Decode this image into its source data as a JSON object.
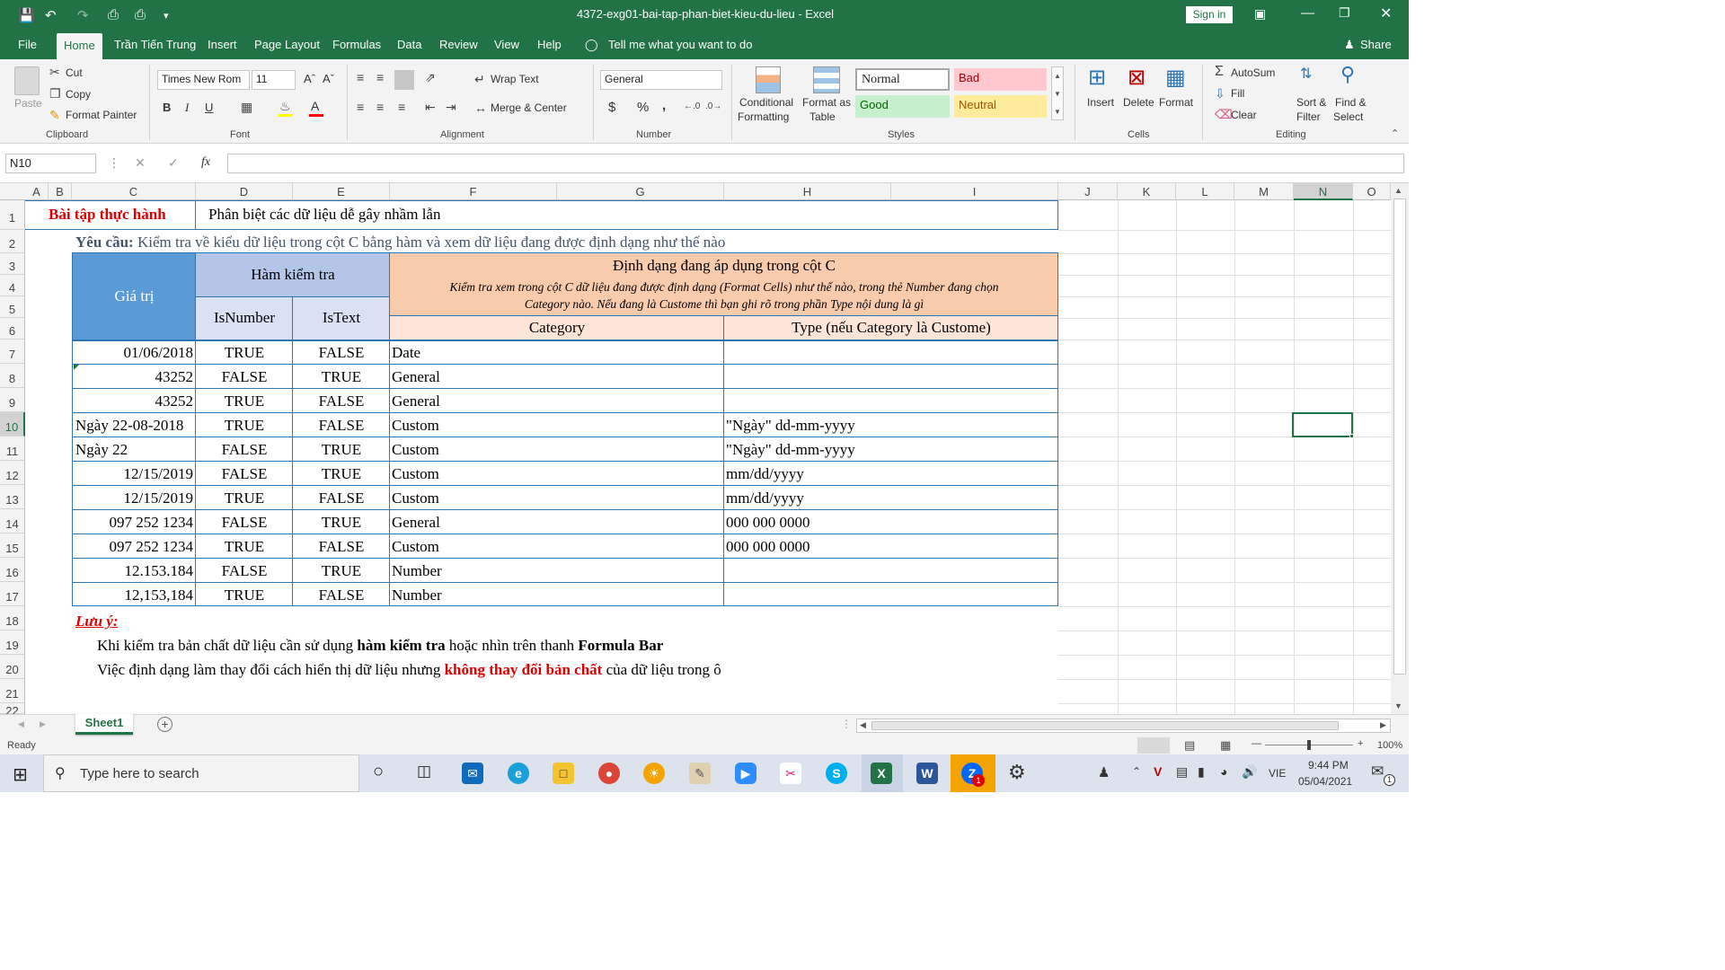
{
  "window": {
    "title": "4372-exg01-bai-tap-phan-biet-kieu-du-lieu  -  Excel",
    "sign_in": "Sign in"
  },
  "tabs": [
    "File",
    "Home",
    "Trần Tiến Trung",
    "Insert",
    "Page Layout",
    "Formulas",
    "Data",
    "Review",
    "View",
    "Help"
  ],
  "tell_me": "Tell me what you want to do",
  "share": "Share",
  "ribbon": {
    "clipboard": {
      "paste": "Paste",
      "cut": "Cut",
      "copy": "Copy",
      "format_painter": "Format Painter",
      "label": "Clipboard"
    },
    "font": {
      "name": "Times New Rom",
      "size": "11",
      "label": "Font",
      "bold": "B",
      "italic": "I",
      "underline": "U"
    },
    "alignment": {
      "wrap_text": "Wrap Text",
      "merge_center": "Merge & Center",
      "label": "Alignment"
    },
    "number": {
      "format": "General",
      "label": "Number",
      "currency": "$",
      "percent": "%",
      "comma": ","
    },
    "styles": {
      "conditional": [
        "Conditional",
        "Formatting"
      ],
      "format_as_table": [
        "Format as",
        "Table"
      ],
      "normal": "Normal",
      "bad": "Bad",
      "good": "Good",
      "neutral": "Neutral",
      "label": "Styles"
    },
    "cells": {
      "insert": "Insert",
      "delete": "Delete",
      "format": "Format",
      "label": "Cells"
    },
    "editing": {
      "autosum": "AutoSum",
      "fill": "Fill",
      "clear": "Clear",
      "sort": [
        "Sort &",
        "Filter"
      ],
      "find": [
        "Find &",
        "Select"
      ],
      "label": "Editing"
    }
  },
  "formula_bar": {
    "name_box": "N10",
    "fx": "fx",
    "value": ""
  },
  "columns": [
    "A",
    "B",
    "C",
    "D",
    "E",
    "F",
    "G",
    "H",
    "I",
    "J",
    "K",
    "L",
    "M",
    "N",
    "O"
  ],
  "rows": [
    "1",
    "2",
    "3",
    "4",
    "5",
    "6",
    "7",
    "8",
    "9",
    "10",
    "11",
    "12",
    "13",
    "14",
    "15",
    "16",
    "17",
    "18",
    "19",
    "20",
    "21",
    "22"
  ],
  "sheet": {
    "title_left": "Bài tập thực hành",
    "title_right": "Phân biệt các dữ liệu dễ gây nhầm lẫn",
    "req_label": "Yêu cầu:",
    "req_text": " Kiểm tra về kiểu dữ liệu trong cột C bằng hàm và xem dữ liệu đang được định dạng như thế nào",
    "hdr_value": "Giá trị",
    "hdr_check": "Hàm kiểm tra",
    "hdr_isnumber": "IsNumber",
    "hdr_istext": "IsText",
    "hdr_format": "Định dạng đang áp dụng trong cột C",
    "hdr_format_note1": "Kiểm tra xem trong cột C dữ liệu đang được định dạng (Format Cells) như thế nào, trong thẻ Number đang chọn",
    "hdr_format_note2": "Category nào. Nếu đang là Custome thì bạn ghi rõ trong phần Type nội dung là gì",
    "hdr_category": "Category",
    "hdr_type": "Type (nếu Category là Custome)",
    "data": [
      {
        "value": "01/06/2018",
        "align": "right",
        "isnumber": "TRUE",
        "istext": "FALSE",
        "category": "Date",
        "type": ""
      },
      {
        "value": "43252",
        "align": "right",
        "isnumber": "FALSE",
        "istext": "TRUE",
        "category": "General",
        "type": ""
      },
      {
        "value": "43252",
        "align": "right",
        "isnumber": "TRUE",
        "istext": "FALSE",
        "category": "General",
        "type": ""
      },
      {
        "value": "Ngày 22-08-2018",
        "align": "left",
        "isnumber": "TRUE",
        "istext": "FALSE",
        "category": "Custom",
        "type": "\"Ngày\" dd-mm-yyyy"
      },
      {
        "value": "Ngày 22",
        "align": "left",
        "isnumber": "FALSE",
        "istext": "TRUE",
        "category": "Custom",
        "type": "\"Ngày\" dd-mm-yyyy"
      },
      {
        "value": "12/15/2019",
        "align": "right",
        "isnumber": "FALSE",
        "istext": "TRUE",
        "category": "Custom",
        "type": "mm/dd/yyyy"
      },
      {
        "value": "12/15/2019",
        "align": "right",
        "isnumber": "TRUE",
        "istext": "FALSE",
        "category": "Custom",
        "type": "mm/dd/yyyy"
      },
      {
        "value": "097 252 1234",
        "align": "right",
        "isnumber": "FALSE",
        "istext": "TRUE",
        "category": "General",
        "type": "000 000 0000"
      },
      {
        "value": "097 252 1234",
        "align": "right",
        "isnumber": "TRUE",
        "istext": "FALSE",
        "category": "Custom",
        "type": "000 000 0000"
      },
      {
        "value": "12.153.184",
        "align": "right",
        "isnumber": "FALSE",
        "istext": "TRUE",
        "category": "Number",
        "type": ""
      },
      {
        "value": "12,153,184",
        "align": "right",
        "isnumber": "TRUE",
        "istext": "FALSE",
        "category": "Number",
        "type": ""
      }
    ],
    "note_label": "Lưu ý:",
    "note1_a": "Khi kiểm tra bản chất dữ liệu cần sử dụng ",
    "note1_b": "hàm kiểm tra",
    "note1_c": " hoặc nhìn trên thanh ",
    "note1_d": "Formula Bar",
    "note2_a": "Việc định dạng làm thay đổi cách hiển thị dữ liệu nhưng ",
    "note2_b": "không thay đổi bản chất",
    "note2_c": " của dữ liệu trong ô"
  },
  "sheet_tab": "Sheet1",
  "status": {
    "ready": "Ready",
    "zoom": "100%"
  },
  "taskbar": {
    "search": "Type here to search",
    "lang": "VIE",
    "time": "9:44 PM",
    "date": "05/04/2021",
    "zalo_badge": "1",
    "notif": "1"
  }
}
